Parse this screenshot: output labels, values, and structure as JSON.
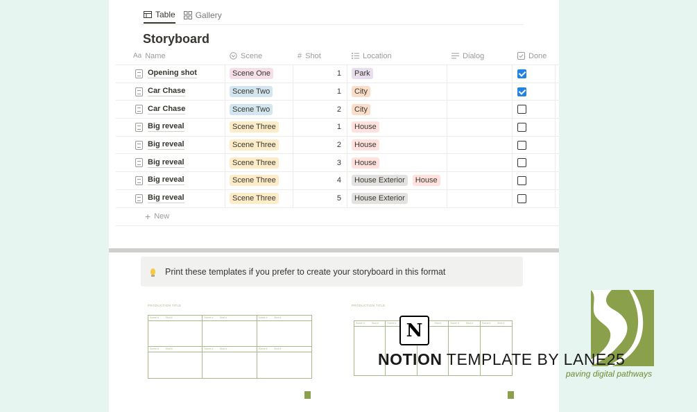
{
  "tabs": [
    {
      "label": "Table",
      "active": true
    },
    {
      "label": "Gallery",
      "active": false
    }
  ],
  "database_title": "Storyboard",
  "columns": {
    "name": "Name",
    "scene": "Scene",
    "shot": "Shot",
    "location": "Location",
    "dialog": "Dialog",
    "done": "Done"
  },
  "rows": [
    {
      "name": "Opening shot",
      "scene": "Scene One",
      "shot": "1",
      "locations": [
        "Park"
      ],
      "done": true
    },
    {
      "name": "Car Chase",
      "scene": "Scene Two",
      "shot": "1",
      "locations": [
        "City"
      ],
      "done": true
    },
    {
      "name": "Car Chase",
      "scene": "Scene Two",
      "shot": "2",
      "locations": [
        "City"
      ],
      "done": false
    },
    {
      "name": "Big reveal",
      "scene": "Scene Three",
      "shot": "1",
      "locations": [
        "House"
      ],
      "done": false
    },
    {
      "name": "Big reveal",
      "scene": "Scene Three",
      "shot": "2",
      "locations": [
        "House"
      ],
      "done": false
    },
    {
      "name": "Big reveal",
      "scene": "Scene Three",
      "shot": "3",
      "locations": [
        "House"
      ],
      "done": false
    },
    {
      "name": "Big reveal",
      "scene": "Scene Three",
      "shot": "4",
      "locations": [
        "House Exterior",
        "House"
      ],
      "done": false
    },
    {
      "name": "Big reveal",
      "scene": "Scene Three",
      "shot": "5",
      "locations": [
        "House Exterior"
      ],
      "done": false
    }
  ],
  "new_label": "New",
  "callout_text": "Print these templates if you prefer to create your storyboard in this format",
  "thumbnail_title": "PRODUCTION TITLE",
  "branding": {
    "word1": "NOTION",
    "word2": " TEMPLATE",
    "word3": " BY LANE25",
    "tagline": "paving digital pathways",
    "notion_glyph": "N"
  },
  "colors": {
    "scene": {
      "Scene One": "#f5e0e9",
      "Scene Two": "#d3e5ef",
      "Scene Three": "#fdecc8"
    },
    "location": {
      "Park": "#e8deee",
      "City": "#fadec9",
      "House": "#ffe2dd",
      "House Exterior": "#e3e2e0"
    },
    "accent": "#2383e2",
    "brand_green": "#8aa04a"
  }
}
